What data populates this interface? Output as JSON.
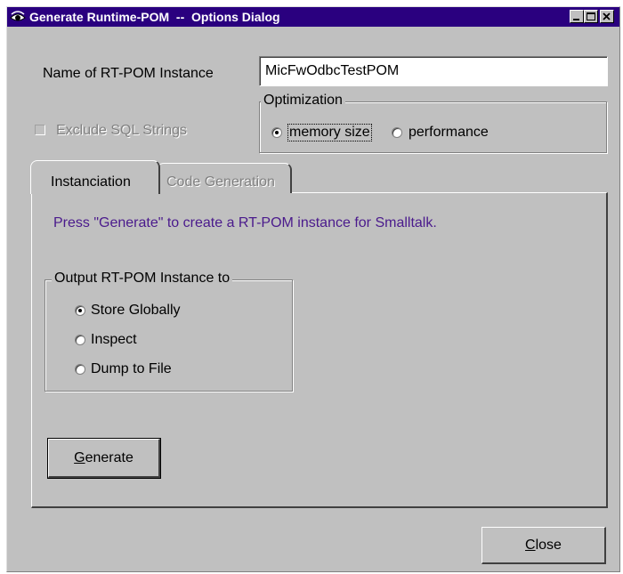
{
  "window": {
    "title": "Generate Runtime-POM  --  Options Dialog",
    "title_icon": "eye-icon",
    "controls": [
      "minimize-icon",
      "maximize-icon",
      "close-icon"
    ]
  },
  "instance_name": {
    "label": "Name of RT-POM Instance",
    "value": "MicFwOdbcTestPOM"
  },
  "exclude_sql": {
    "label": "Exclude SQL Strings",
    "checked": false,
    "enabled": false
  },
  "optimization": {
    "label": "Optimization",
    "options": [
      {
        "label": "memory size",
        "selected": true
      },
      {
        "label": "performance",
        "selected": false
      }
    ]
  },
  "tabs": [
    {
      "label": "Instanciation",
      "active": true
    },
    {
      "label": "Code Generation",
      "active": false,
      "enabled": false
    }
  ],
  "instanciation": {
    "message": "Press \"Generate\" to create a RT-POM instance for Smalltalk.",
    "output_group_label": "Output RT-POM Instance to",
    "output_options": [
      {
        "label": "Store Globally",
        "selected": true
      },
      {
        "label": "Inspect",
        "selected": false
      },
      {
        "label": "Dump to File",
        "selected": false
      }
    ],
    "generate_button": "Generate"
  },
  "close_button": "Close",
  "colors": {
    "title_bar": "#2a007f",
    "message_text": "#4a1a8c",
    "face": "#c0c0c0"
  }
}
